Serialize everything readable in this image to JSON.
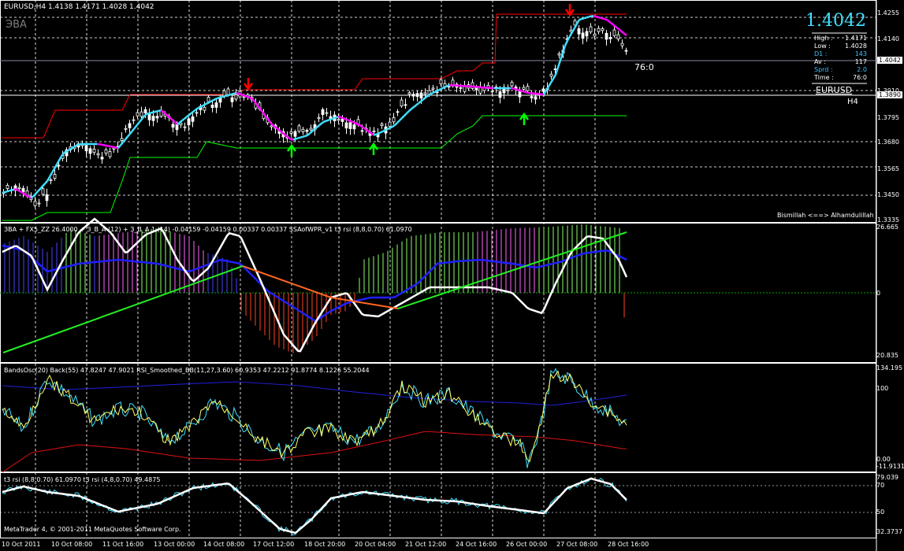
{
  "window": {
    "symbol_header": "EURUSD,H4  1.4138 1.4171 1.4028 1.4042",
    "indicator_name": "ЭВА",
    "footer": "MetaTrader 4, © 2001-2011 MetaQuotes Software Corp."
  },
  "info_panel": {
    "price": "1.4042",
    "rows": [
      {
        "k": "High",
        "v": "1.4171",
        "color": "#ffffff"
      },
      {
        "k": "Low",
        "v": "1.4028",
        "color": "#ffffff"
      },
      {
        "k": "D1",
        "v": "143",
        "color": "#40c0ff"
      },
      {
        "k": "Av",
        "v": "117",
        "color": "#ffffff"
      },
      {
        "k": "Sprd",
        "v": "2.0",
        "color": "#40c0ff"
      },
      {
        "k": "Time",
        "v": "76:0",
        "color": "#ffffff"
      }
    ],
    "symbol": "EURUSD",
    "timeframe": "H4",
    "timer": "76:0",
    "greeting": "Bismillah <==> Alhamdulillah"
  },
  "price_axis": {
    "ticks": [
      "1.4255",
      "1.4140",
      "1.4042",
      "1.3910",
      "1.3890",
      "1.3795",
      "1.3680",
      "1.3565",
      "1.3450",
      "1.3335"
    ],
    "current": "1.4042",
    "level": "1.3890"
  },
  "pane2": {
    "title": "ЗВА + FX5_ZZ 26.4000 + З_В_А (12) + З_В_А 1 (14) -0.04159 -0.04159 0.00337 0.00337  SSAofWPR_v1  t3 rsi (8,8,0.70) 61.0970",
    "axis": [
      "26.665",
      "0",
      "20.835"
    ]
  },
  "pane3": {
    "title": "BandsOsc(20) Back(55) 47.8247 47.9021  RSI_Smoothed_BB(11,27,3.60) 60.9353 47.2212 91.8774 8.1226 55.2044",
    "axis": [
      "134.195",
      "100",
      "0.00",
      "-11.9131"
    ]
  },
  "pane4": {
    "title": "t3 rsi (8,8,0.70) 61.0970  t3 rsi (4,8,0.70) 49.4875",
    "axis": [
      "79.039",
      "70",
      "50",
      "32.3737"
    ]
  },
  "time_axis": [
    "10 Oct 2011",
    "10 Oct 08:00",
    "11 Oct 16:00",
    "13 Oct 00:00",
    "14 Oct 08:00",
    "17 Oct 12:00",
    "18 Oct 20:00",
    "20 Oct 04:00",
    "21 Oct 12:00",
    "24 Oct 16:00",
    "26 Oct 00:00",
    "27 Oct 08:00",
    "28 Oct 16:00"
  ],
  "colors": {
    "up_candle": "#ffffff",
    "down_candle": "#000000",
    "upper_band": "#ff0000",
    "lower_band": "#00ff00",
    "ma_up": "#40e0ff",
    "ma_down": "#ff00ff",
    "grid": "#ffffff"
  }
}
